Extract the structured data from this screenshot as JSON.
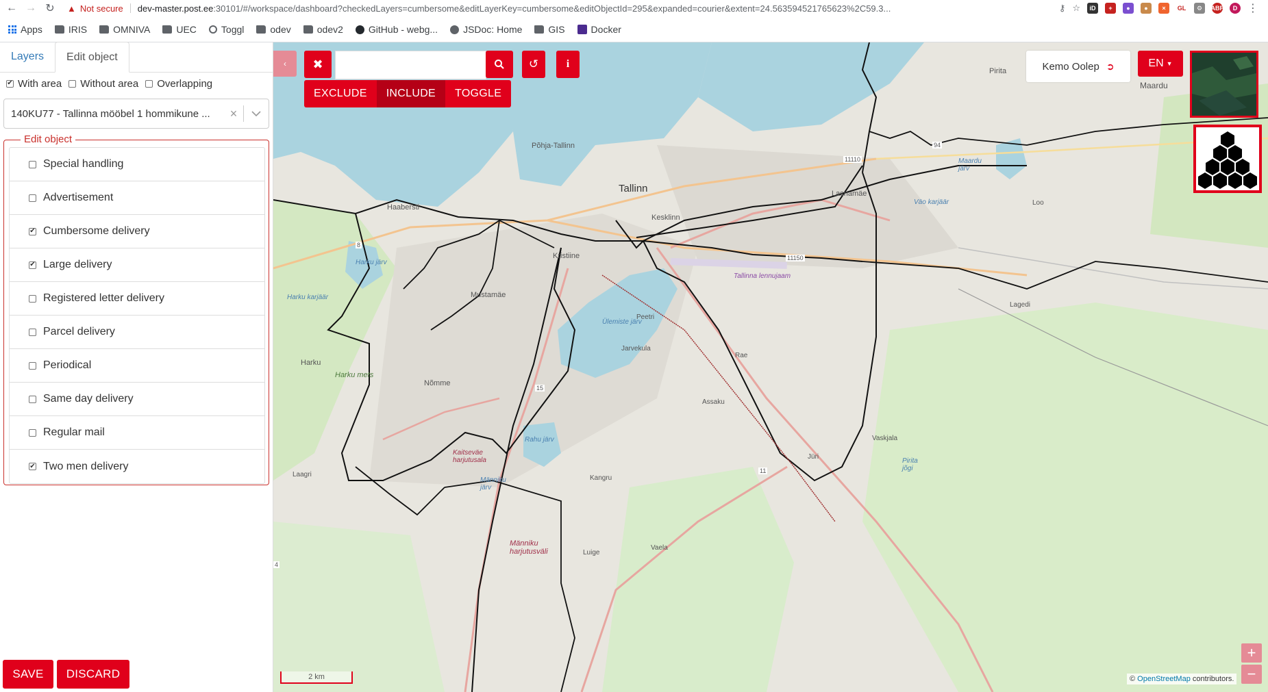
{
  "browser": {
    "security": "Not secure",
    "url_host": "dev-master.post.ee",
    "url_rest": ":30101/#/workspace/dashboard?checkedLayers=cumbersome&editLayerKey=cumbersome&editObjectId=295&expanded=courier&extent=24.563594521765623%2C59.3...",
    "bookmarks": [
      "Apps",
      "IRIS",
      "OMNIVA",
      "UEC",
      "Toggl",
      "odev",
      "odev2",
      "GitHub - webg...",
      "JSDoc: Home",
      "GIS",
      "Docker"
    ],
    "profile_initial": "D"
  },
  "sidebar": {
    "tabs": [
      "Layers",
      "Edit object"
    ],
    "filters": [
      {
        "label": "With area",
        "checked": true
      },
      {
        "label": "Without area",
        "checked": false
      },
      {
        "label": "Overlapping",
        "checked": false
      }
    ],
    "selected_object": "140KU77 - Tallinna mööbel 1 hommikune ...",
    "edit_legend": "Edit object",
    "options": [
      {
        "label": "Special handling",
        "checked": false
      },
      {
        "label": "Advertisement",
        "checked": false
      },
      {
        "label": "Cumbersome delivery",
        "checked": true
      },
      {
        "label": "Large delivery",
        "checked": true
      },
      {
        "label": "Registered letter delivery",
        "checked": false
      },
      {
        "label": "Parcel delivery",
        "checked": false
      },
      {
        "label": "Periodical",
        "checked": false
      },
      {
        "label": "Same day delivery",
        "checked": false
      },
      {
        "label": "Regular mail",
        "checked": false
      },
      {
        "label": "Two men delivery",
        "checked": true
      }
    ],
    "save_label": "SAVE",
    "discard_label": "DISCARD"
  },
  "map": {
    "search_placeholder": "",
    "mode_buttons": [
      "EXCLUDE",
      "INCLUDE",
      "TOGGLE"
    ],
    "active_mode": "INCLUDE",
    "user_name": "Kemo Oolep",
    "language": "EN",
    "scale_label": "2 km",
    "attribution_prefix": "©",
    "attribution_link": "OpenStreetMap",
    "attribution_suffix": "contributors.",
    "labels": [
      "Pirita",
      "Maardu",
      "Põhja-Tallinn",
      "Tallinn",
      "Lasnamäe",
      "Väo karjäär",
      "Loo",
      "Haabersti",
      "Kesklinn",
      "Kristiine",
      "Harku järv",
      "Mustamäe",
      "Tallinna lennujaam",
      "Lagedi",
      "Harku karjäär",
      "Ülemiste järv",
      "Peetri",
      "Jarvekula",
      "Rae",
      "Harku",
      "Harku mets",
      "Nõmme",
      "Assaku",
      "Rahu järv",
      "Vaskjala",
      "Kaitseväe harjutusala",
      "Jüri",
      "Laagri",
      "Männiku järv",
      "Kangru",
      "Pirita jõgi",
      "Männiku harjutusväli",
      "Luige",
      "Vaela",
      "Maardu järv"
    ],
    "road_numbers": [
      "94",
      "11110",
      "8",
      "11150",
      "15",
      "11",
      "4"
    ],
    "colors": {
      "accent": "#e0001b",
      "water": "#aad3df",
      "land": "#e8e6df",
      "green": "#cfe6b8"
    }
  }
}
